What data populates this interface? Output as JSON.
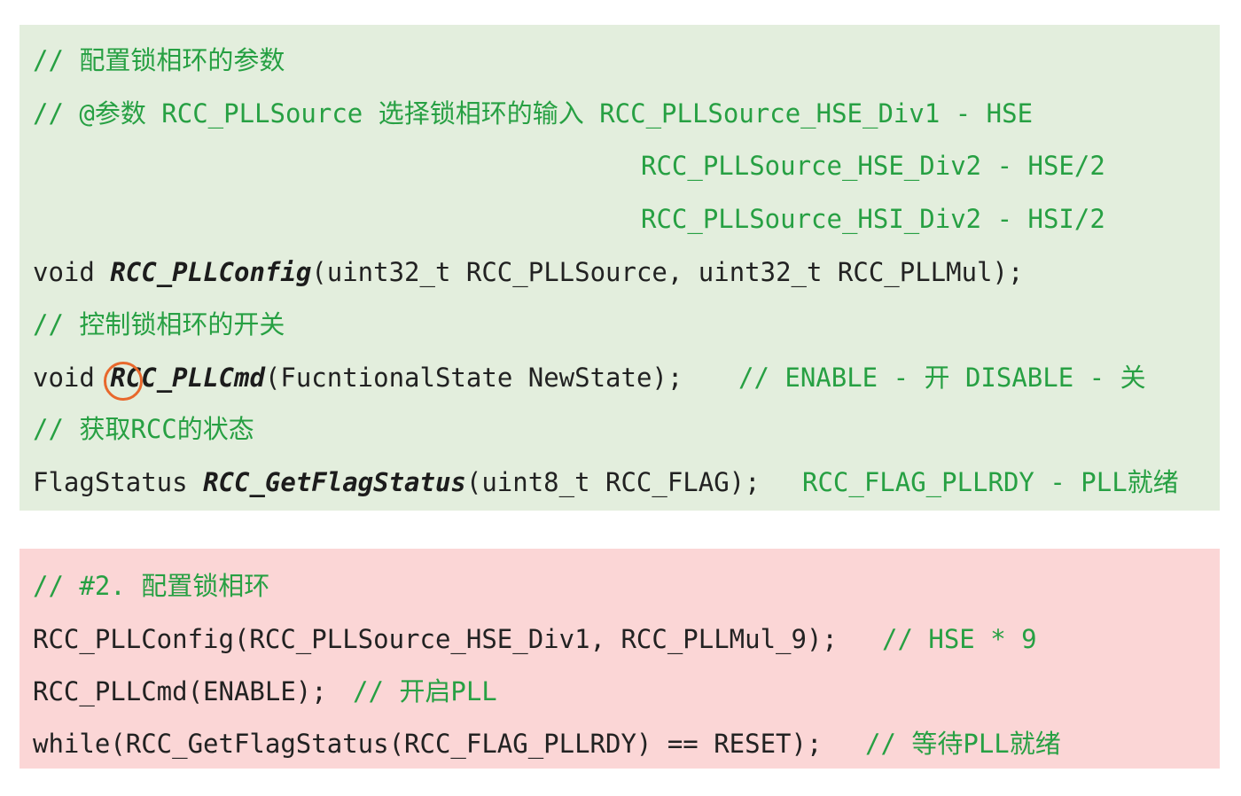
{
  "green": {
    "l1": "// 配置锁相环的参数",
    "l2": "// @参数 RCC_PLLSource 选择锁相环的输入 RCC_PLLSource_HSE_Div1 - HSE",
    "l3": "RCC_PLLSource_HSE_Div2 - HSE/2",
    "l4": "RCC_PLLSource_HSI_Div2 - HSI/2",
    "l5": {
      "kw": "void ",
      "fn": "RCC_PLLConfig",
      "args": "(uint32_t RCC_PLLSource, uint32_t RCC_PLLMul);"
    },
    "l6": "// 控制锁相环的开关",
    "l7": {
      "kw": "void ",
      "fn": "RCC_PLLCmd",
      "args": "(FucntionalState NewState);",
      "comment": "// ENABLE - 开 DISABLE - 关"
    },
    "l8": "// 获取RCC的状态",
    "l9": {
      "kw": "FlagStatus ",
      "fn": "RCC_GetFlagStatus",
      "args": "(uint8_t RCC_FLAG);",
      "comment": "RCC_FLAG_PLLRDY - PLL就绪"
    }
  },
  "red": {
    "l1": "// #2. 配置锁相环",
    "l2": {
      "code": "RCC_PLLConfig(RCC_PLLSource_HSE_Div1, RCC_PLLMul_9);",
      "comment": "// HSE * 9"
    },
    "l3": {
      "code": "RCC_PLLCmd(ENABLE);",
      "comment": "// 开启PLL"
    },
    "l4": {
      "code": "while(RCC_GetFlagStatus(RCC_FLAG_PLLRDY) == RESET);",
      "comment": "// 等待PLL就绪"
    }
  },
  "colors": {
    "green_panel": "#e3eedd",
    "red_panel": "#fbd6d6",
    "comment": "#27a043",
    "annotation_circle": "#e8682c"
  }
}
